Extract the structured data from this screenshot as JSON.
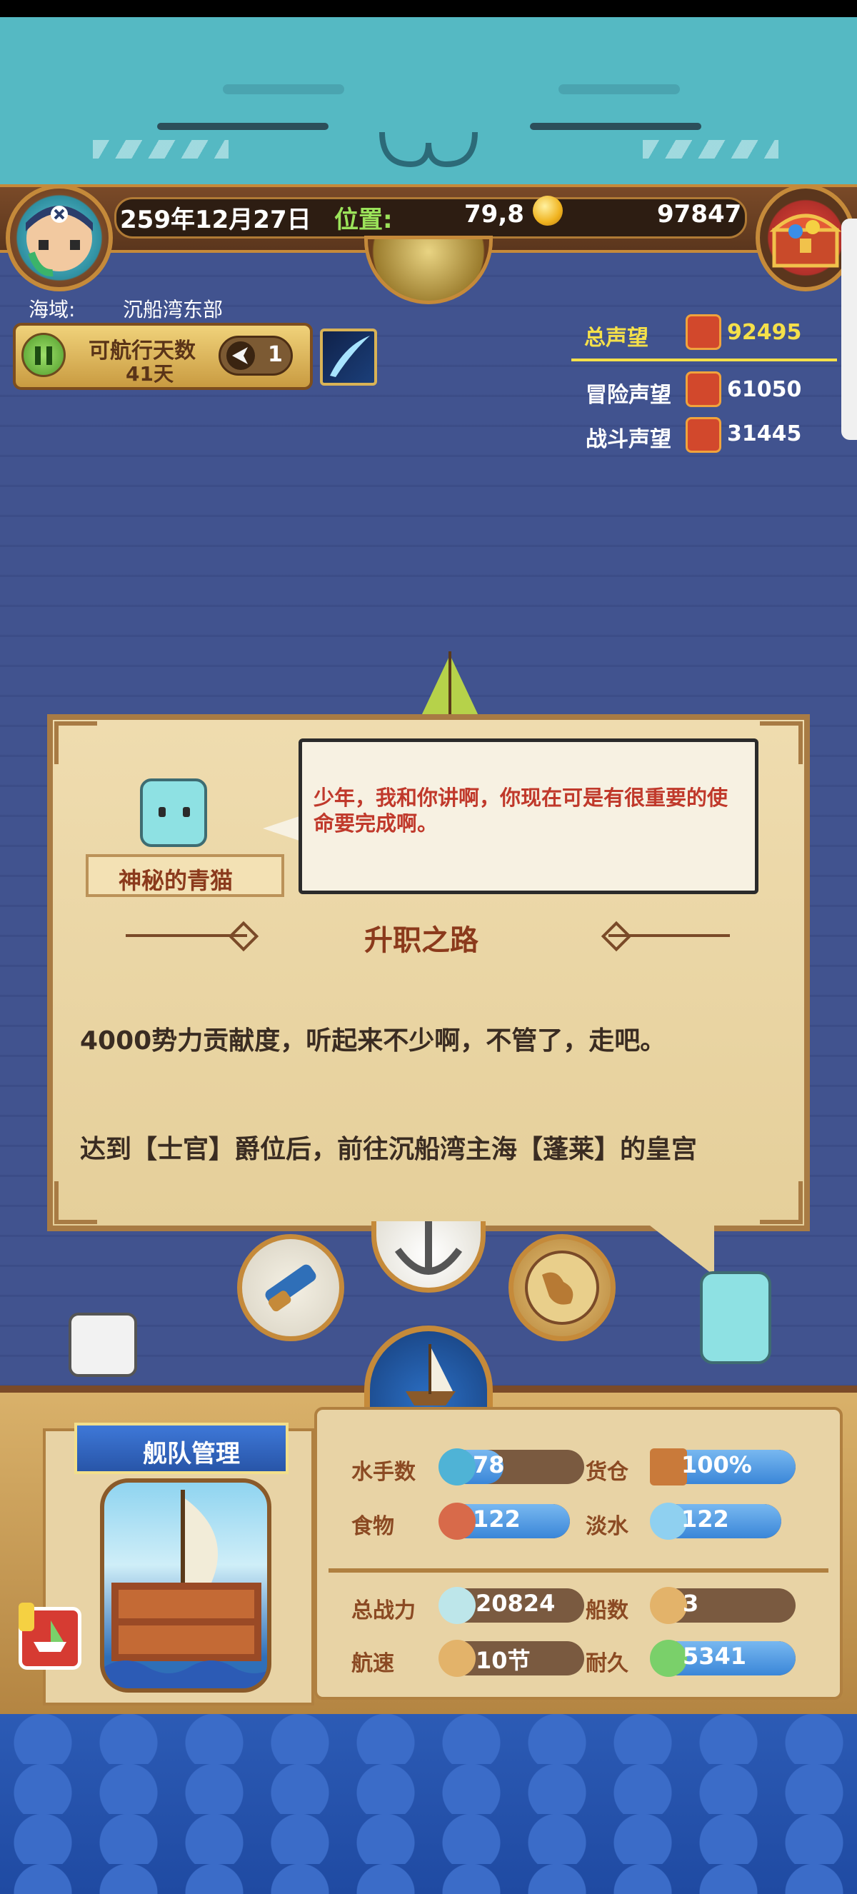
{
  "hud": {
    "date": "259年12月27日",
    "position_label": "位置:",
    "position_value": "79,8",
    "gold": "97847"
  },
  "region": {
    "label": "海域:",
    "value": "沉船湾东部"
  },
  "voyage": {
    "days_label": "可航行天数",
    "days_value": "41天",
    "speed_multiplier": "1"
  },
  "reputation": {
    "total_label": "总声望",
    "total_value": "92495",
    "adventure_label": "冒险声望",
    "adventure_value": "61050",
    "battle_label": "战斗声望",
    "battle_value": "31445"
  },
  "dialog": {
    "speaker_name": "神秘的青猫",
    "speech_text": "少年，我和你讲啊，你现在可是有很重要的使命要完成啊。",
    "section_title": "升职之路",
    "paragraph_1": "4000势力贡献度，听起来不少啊，不管了，走吧。",
    "paragraph_2": "达到【士官】爵位后，前往沉船湾主海【蓬莱】的皇宫"
  },
  "fleet": {
    "title": "舰队管理",
    "stats": [
      {
        "label": "水手数",
        "value": "78",
        "fill": 0.4,
        "icon": "sailor-icon"
      },
      {
        "label": "货仓",
        "value": "100%",
        "fill": 1.0,
        "icon": "cargo-icon"
      },
      {
        "label": "食物",
        "value": "122",
        "fill": 1.0,
        "icon": "food-icon"
      },
      {
        "label": "淡水",
        "value": "122",
        "fill": 1.0,
        "icon": "water-icon"
      },
      {
        "label": "总战力",
        "value": "20824",
        "fill": 0,
        "icon": "power-icon"
      },
      {
        "label": "船数",
        "value": "3",
        "fill": 0,
        "icon": "ship-count-icon"
      },
      {
        "label": "航速",
        "value": "10节",
        "fill": 0,
        "icon": "speed-icon"
      },
      {
        "label": "耐久",
        "value": "5341",
        "fill": 1.0,
        "icon": "durability-icon"
      }
    ]
  },
  "colors": {
    "sea": "#41538f",
    "cat": "#55b9c3",
    "wood": "#7a4a28",
    "gold_text": "#f5e04a",
    "position_green": "#9be35a",
    "speech_red": "#c0392b",
    "title_brown": "#8b3a1c"
  }
}
